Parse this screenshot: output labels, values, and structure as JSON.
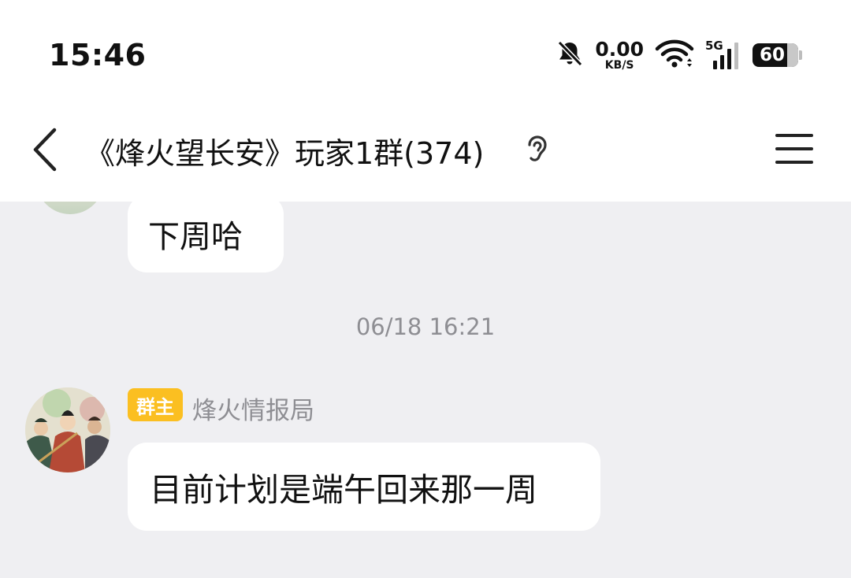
{
  "status_bar": {
    "time": "15:46",
    "net_speed_value": "0.00",
    "net_speed_unit": "KB/S",
    "network_type": "5G",
    "battery_level": "60",
    "icons": [
      "bell-muted-icon",
      "wifi-icon",
      "cellular-signal-icon",
      "battery-icon"
    ]
  },
  "nav": {
    "title": "《烽火望长安》玩家1群(374)",
    "icons": [
      "back-chevron-icon",
      "ear-icon",
      "menu-icon"
    ]
  },
  "messages": [
    {
      "text": "下周哈"
    },
    {
      "timestamp": "06/18 16:21"
    },
    {
      "role_badge": "群主",
      "sender": "烽火情报局",
      "text": "目前计划是端午回来那一周"
    }
  ],
  "colors": {
    "background": "#efeff2",
    "bubble": "#ffffff",
    "badge": "#fbbf21",
    "secondary_text": "#8e8e93"
  }
}
